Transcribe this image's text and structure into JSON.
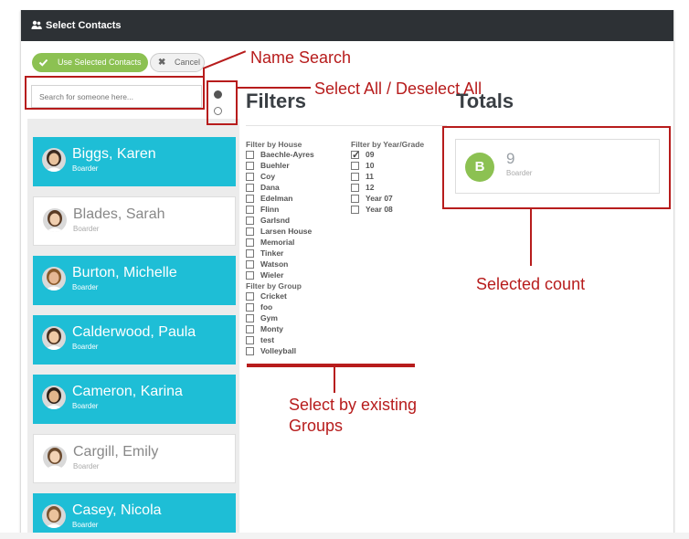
{
  "window": {
    "title": "Select Contacts",
    "icon": "users-icon"
  },
  "toolbar": {
    "use_selected_label": "Use Selected Contacts",
    "cancel_label": "Cancel"
  },
  "search": {
    "placeholder": "Search for someone here..."
  },
  "contacts": [
    {
      "name": "Biggs, Karen",
      "role": "Boarder",
      "selected": true
    },
    {
      "name": "Blades, Sarah",
      "role": "Boarder",
      "selected": false
    },
    {
      "name": "Burton, Michelle",
      "role": "Boarder",
      "selected": true
    },
    {
      "name": "Calderwood, Paula",
      "role": "Boarder",
      "selected": true
    },
    {
      "name": "Cameron, Karina",
      "role": "Boarder",
      "selected": true
    },
    {
      "name": "Cargill, Emily",
      "role": "Boarder",
      "selected": false
    },
    {
      "name": "Casey, Nicola",
      "role": "Boarder",
      "selected": true
    }
  ],
  "filters": {
    "heading": "Filters",
    "house": {
      "title": "Filter by House",
      "items": [
        "Baechle-Ayres",
        "Buehler",
        "Coy",
        "Dana",
        "Edelman",
        "Flinn",
        "Garlsnd",
        "Larsen House",
        "Memorial",
        "Tinker",
        "Watson",
        "Wieler"
      ]
    },
    "group": {
      "title": "Filter by Group",
      "items": [
        "Cricket",
        "foo",
        "Gym",
        "Monty",
        "test",
        "Volleyball"
      ]
    },
    "year": {
      "title": "Filter by Year/Grade",
      "items": [
        {
          "label": "09",
          "checked": true
        },
        {
          "label": "10",
          "checked": false
        },
        {
          "label": "11",
          "checked": false
        },
        {
          "label": "12",
          "checked": false
        },
        {
          "label": "Year 07",
          "checked": false
        },
        {
          "label": "Year 08",
          "checked": false
        }
      ]
    }
  },
  "totals": {
    "heading": "Totals",
    "badge": "B",
    "count": "9",
    "label": "Boarder",
    "badge_color": "#8cc152"
  },
  "annotations": {
    "name_search": "Name Search",
    "select_all": "Select All / Deselect All",
    "selected_count": "Selected count",
    "groups_line1": "Select by existing",
    "groups_line2": "Groups"
  },
  "colors": {
    "selected_card": "#1ebed6",
    "titlebar": "#2d3135",
    "annotation": "#b71c1c",
    "accent_green": "#8cc152"
  }
}
